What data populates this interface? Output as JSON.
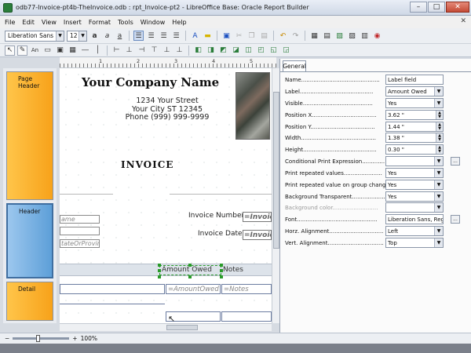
{
  "window": {
    "title": "odb77-Invoice-pt4b-TheInvoice.odb : rpt_Invoice-pt2 - LibreOffice Base: Oracle Report Builder",
    "minimize": "–",
    "maximize": "□",
    "close": "✕"
  },
  "menu": [
    "File",
    "Edit",
    "View",
    "Insert",
    "Format",
    "Tools",
    "Window",
    "Help"
  ],
  "menu_close": "✕",
  "toolbar": {
    "font_name": "Liberation Sans",
    "font_size": "12"
  },
  "ruler": {
    "marks": [
      "1",
      "2",
      "3",
      "4",
      "5"
    ]
  },
  "sections": {
    "page_header": "Page Header",
    "header": "Header",
    "detail": "Detail"
  },
  "report": {
    "company": "Your Company Name",
    "address1": "1234 Your Street",
    "address2": "Your City ST 12345",
    "phone": "Phone (999) 999-9999",
    "invoice_title": "INVOICE",
    "field_name": "ame",
    "field_state": "tateOrProvin",
    "invoice_number_label": "Invoice Number:",
    "invoice_number_field": "=Invoic",
    "invoice_date_label": "Invoice Date:",
    "invoice_date_field": "=Invoic",
    "col_amount": "Amount Owed",
    "col_notes": "Notes",
    "detail_amount": "=AmountOwed",
    "detail_notes": "=Notes"
  },
  "status": {
    "zoom": "100%"
  },
  "properties": {
    "tab": "General",
    "rows": [
      {
        "label": "Name.............................................",
        "value": "Label field",
        "kind": "text"
      },
      {
        "label": "Label..........................................",
        "value": "Amount Owed",
        "kind": "combo"
      },
      {
        "label": "Visible........................................",
        "value": "Yes",
        "kind": "combo"
      },
      {
        "label": "Position X.....................................",
        "value": "3.62 \"",
        "kind": "spin"
      },
      {
        "label": "Position Y.....................................",
        "value": "1.44 \"",
        "kind": "spin"
      },
      {
        "label": "Width...........................................",
        "value": "1.38 \"",
        "kind": "spin"
      },
      {
        "label": "Height..........................................",
        "value": "0.30 \"",
        "kind": "spin"
      },
      {
        "label": "Conditional Print Expression.............",
        "value": "",
        "kind": "combo-btn"
      },
      {
        "label": "Print repeated values......................",
        "value": "Yes",
        "kind": "combo"
      },
      {
        "label": "Print repeated value on group change.....",
        "value": "Yes",
        "kind": "combo"
      },
      {
        "label": "Background Transparent....................",
        "value": "Yes",
        "kind": "combo"
      },
      {
        "label": "Background color..........................",
        "value": "",
        "kind": "combo-dim"
      },
      {
        "label": "Font..............................................",
        "value": "Liberation Sans, Regula",
        "kind": "text-btn"
      },
      {
        "label": "Horz. Alignment...............................",
        "value": "Left",
        "kind": "combo"
      },
      {
        "label": "Vert. Alignment................................",
        "value": "Top",
        "kind": "combo"
      }
    ]
  },
  "colors": {
    "section_orange": "#f7a21a",
    "section_blue": "#5d9fd8",
    "selection_green": "#2a9a2a"
  }
}
